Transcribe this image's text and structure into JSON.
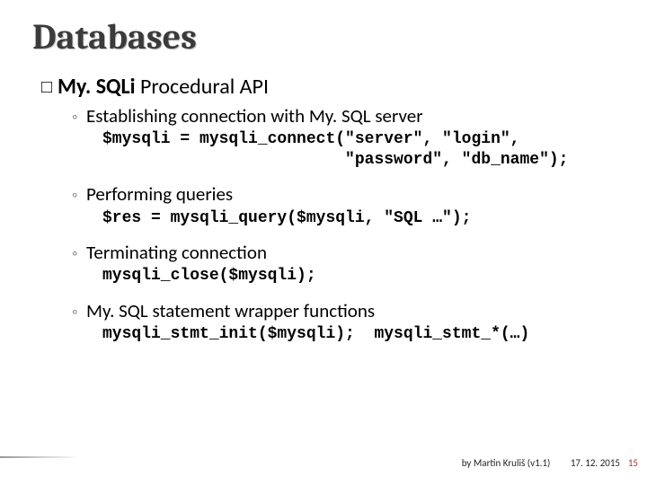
{
  "title": "Databases",
  "h1": {
    "bold": "My. SQLi",
    "rest": " Procedural API"
  },
  "items": [
    {
      "label": "Establishing connection with My. SQL server",
      "code": "$mysqli = mysqli_connect(\"server\", \"login\",\n                         \"password\", \"db_name\");"
    },
    {
      "label": "Performing queries",
      "code": "$res = mysqli_query($mysqli, \"SQL …\");"
    },
    {
      "label": "Terminating connection",
      "code": "mysqli_close($mysqli);"
    },
    {
      "label": "My. SQL statement wrapper functions",
      "code": "mysqli_stmt_init($mysqli);  mysqli_stmt_*(…)"
    }
  ],
  "footer": {
    "by": "by Martin Kruliš (v1.1)",
    "date": "17. 12. 2015",
    "page": "15"
  }
}
